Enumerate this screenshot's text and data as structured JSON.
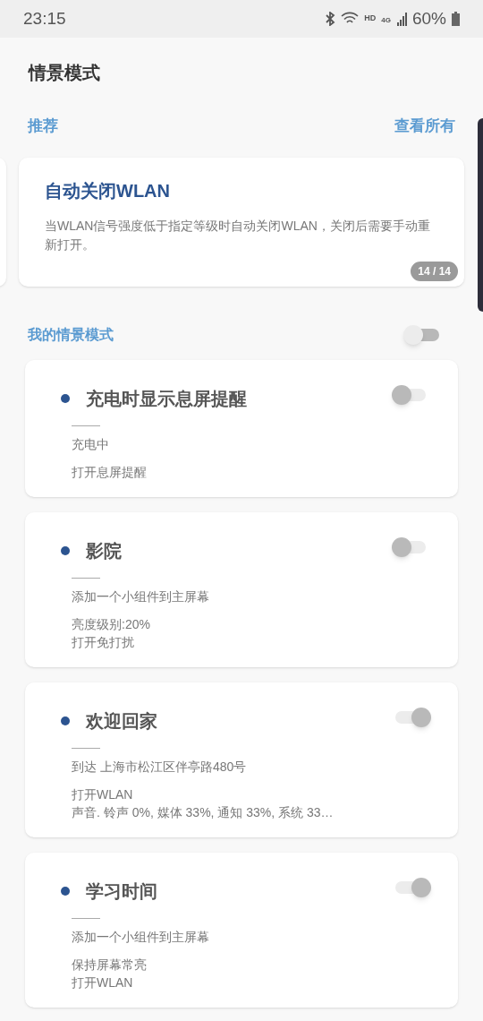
{
  "status_bar": {
    "time": "23:15",
    "network_labels": [
      "HD",
      "4G"
    ],
    "battery": "60%"
  },
  "title": "情景模式",
  "recommended": {
    "label": "推荐",
    "view_all": "查看所有",
    "card": {
      "title": "自动关闭WLAN",
      "description": "当WLAN信号强度低于指定等级时自动关闭WLAN，关闭后需要手动重新打开。",
      "counter": "14 / 14"
    }
  },
  "my_modes": {
    "label": "我的情景模式",
    "on": false,
    "items": [
      {
        "title": "充电时显示息屏提醒",
        "on": false,
        "condition": "充电中",
        "actions": [
          "打开息屏提醒"
        ]
      },
      {
        "title": "影院",
        "on": false,
        "condition": "添加一个小组件到主屏幕",
        "actions": [
          "亮度级别:20%",
          "打开免打扰"
        ]
      },
      {
        "title": "欢迎回家",
        "on": true,
        "condition": "到达 上海市松江区伴亭路480号",
        "actions": [
          "打开WLAN",
          "声音. 铃声 0%, 媒体 33%, 通知 33%, 系统 33…"
        ]
      },
      {
        "title": "学习时间",
        "on": true,
        "condition": "添加一个小组件到主屏幕",
        "actions": [
          "保持屏幕常亮",
          "打开WLAN"
        ]
      }
    ]
  }
}
